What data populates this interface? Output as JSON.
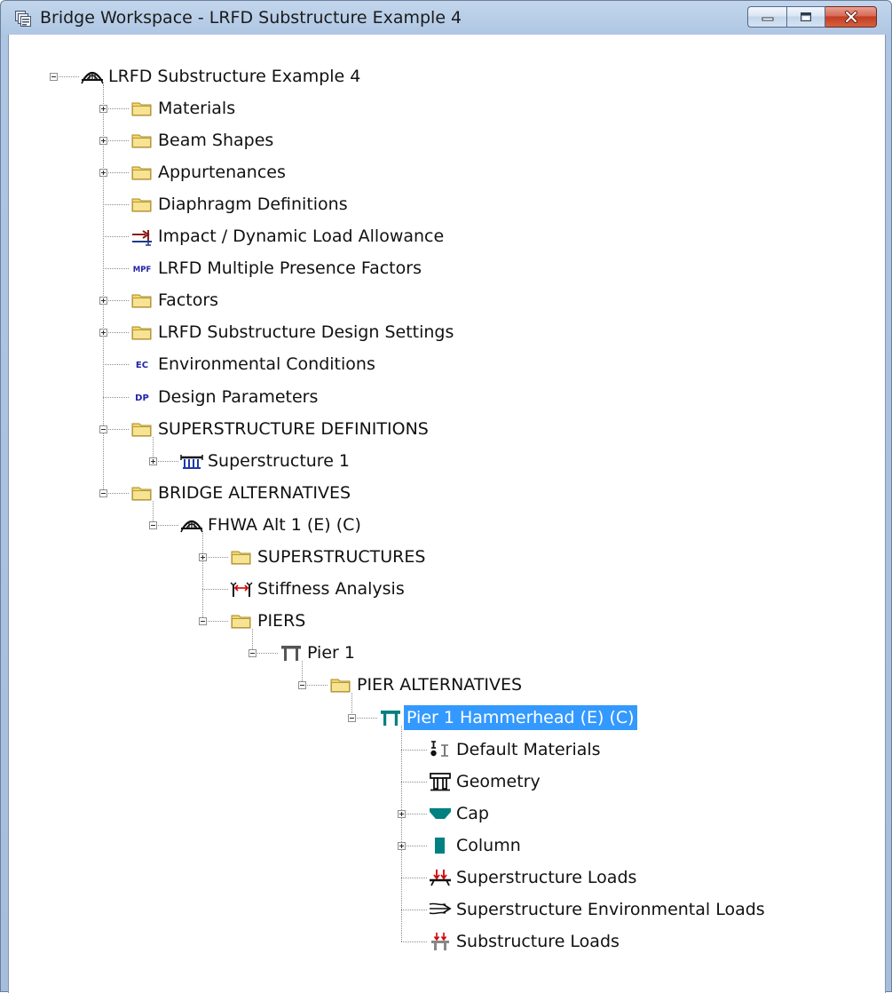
{
  "window": {
    "title": "Bridge Workspace - LRFD Substructure Example 4",
    "controls": {
      "minimize": "minimize-icon",
      "maximize": "maximize-icon",
      "close": "close-icon"
    }
  },
  "colors": {
    "selection": "#3399ff",
    "folder": "#f1d66a",
    "pier_teal": "#008080",
    "load_red": "#d40000",
    "abbrev_blue": "#2222aa"
  },
  "tree": {
    "selected_id": "pier-1-hammerhead",
    "nodes": [
      {
        "id": "root",
        "label": "LRFD Substructure Example 4",
        "depth": 0,
        "expander": "minus",
        "icon": "bridge-arch-icon"
      },
      {
        "id": "materials",
        "label": "Materials",
        "depth": 1,
        "expander": "plus",
        "icon": "folder-icon"
      },
      {
        "id": "beam-shapes",
        "label": "Beam Shapes",
        "depth": 1,
        "expander": "plus",
        "icon": "folder-icon"
      },
      {
        "id": "appurtenances",
        "label": "Appurtenances",
        "depth": 1,
        "expander": "plus",
        "icon": "folder-icon"
      },
      {
        "id": "diaphragm-definitions",
        "label": "Diaphragm Definitions",
        "depth": 1,
        "expander": "none",
        "icon": "folder-icon"
      },
      {
        "id": "impact-dynamic-load-allowance",
        "label": "Impact / Dynamic Load Allowance",
        "depth": 1,
        "expander": "none",
        "icon": "impact-load-icon"
      },
      {
        "id": "lrfd-multiple-presence-factors",
        "label": "LRFD Multiple Presence Factors",
        "depth": 1,
        "expander": "none",
        "icon": "mpf-icon",
        "icon_text": "MPF"
      },
      {
        "id": "factors",
        "label": "Factors",
        "depth": 1,
        "expander": "plus",
        "icon": "folder-icon"
      },
      {
        "id": "lrfd-substructure-design-settings",
        "label": "LRFD Substructure Design Settings",
        "depth": 1,
        "expander": "plus",
        "icon": "folder-icon"
      },
      {
        "id": "environmental-conditions",
        "label": "Environmental Conditions",
        "depth": 1,
        "expander": "none",
        "icon": "ec-icon",
        "icon_text": "EC"
      },
      {
        "id": "design-parameters",
        "label": "Design Parameters",
        "depth": 1,
        "expander": "none",
        "icon": "dp-icon",
        "icon_text": "DP"
      },
      {
        "id": "superstructure-definitions",
        "label": "SUPERSTRUCTURE DEFINITIONS",
        "depth": 1,
        "expander": "minus",
        "icon": "folder-icon"
      },
      {
        "id": "superstructure-1",
        "label": "Superstructure 1",
        "depth": 2,
        "expander": "plus",
        "icon": "superstructure-icon"
      },
      {
        "id": "bridge-alternatives",
        "label": "BRIDGE ALTERNATIVES",
        "depth": 1,
        "expander": "minus",
        "icon": "folder-icon"
      },
      {
        "id": "fhwa-alt-1",
        "label": "FHWA Alt 1 (E) (C)",
        "depth": 2,
        "expander": "minus",
        "icon": "bridge-arch-icon"
      },
      {
        "id": "superstructures",
        "label": "SUPERSTRUCTURES",
        "depth": 3,
        "expander": "plus",
        "icon": "folder-icon"
      },
      {
        "id": "stiffness-analysis",
        "label": "Stiffness Analysis",
        "depth": 3,
        "expander": "none",
        "icon": "stiffness-icon"
      },
      {
        "id": "piers",
        "label": "PIERS",
        "depth": 3,
        "expander": "minus",
        "icon": "folder-icon"
      },
      {
        "id": "pier-1",
        "label": "Pier 1",
        "depth": 4,
        "expander": "minus",
        "icon": "pier-icon"
      },
      {
        "id": "pier-alternatives",
        "label": "PIER ALTERNATIVES",
        "depth": 5,
        "expander": "minus",
        "icon": "folder-icon"
      },
      {
        "id": "pier-1-hammerhead",
        "label": "Pier 1 Hammerhead (E) (C)",
        "depth": 6,
        "expander": "minus",
        "icon": "pier-teal-icon"
      },
      {
        "id": "default-materials",
        "label": "Default Materials",
        "depth": 7,
        "expander": "none",
        "icon": "default-materials-icon"
      },
      {
        "id": "geometry",
        "label": "Geometry",
        "depth": 7,
        "expander": "none",
        "icon": "geometry-icon"
      },
      {
        "id": "cap",
        "label": "Cap",
        "depth": 7,
        "expander": "plus",
        "icon": "cap-icon"
      },
      {
        "id": "column",
        "label": "Column",
        "depth": 7,
        "expander": "plus",
        "icon": "column-icon"
      },
      {
        "id": "superstructure-loads",
        "label": "Superstructure Loads",
        "depth": 7,
        "expander": "none",
        "icon": "superstructure-loads-icon"
      },
      {
        "id": "superstructure-environmental-loads",
        "label": "Superstructure Environmental Loads",
        "depth": 7,
        "expander": "none",
        "icon": "environmental-loads-icon"
      },
      {
        "id": "substructure-loads",
        "label": "Substructure Loads",
        "depth": 7,
        "expander": "none",
        "icon": "substructure-loads-icon"
      }
    ]
  }
}
